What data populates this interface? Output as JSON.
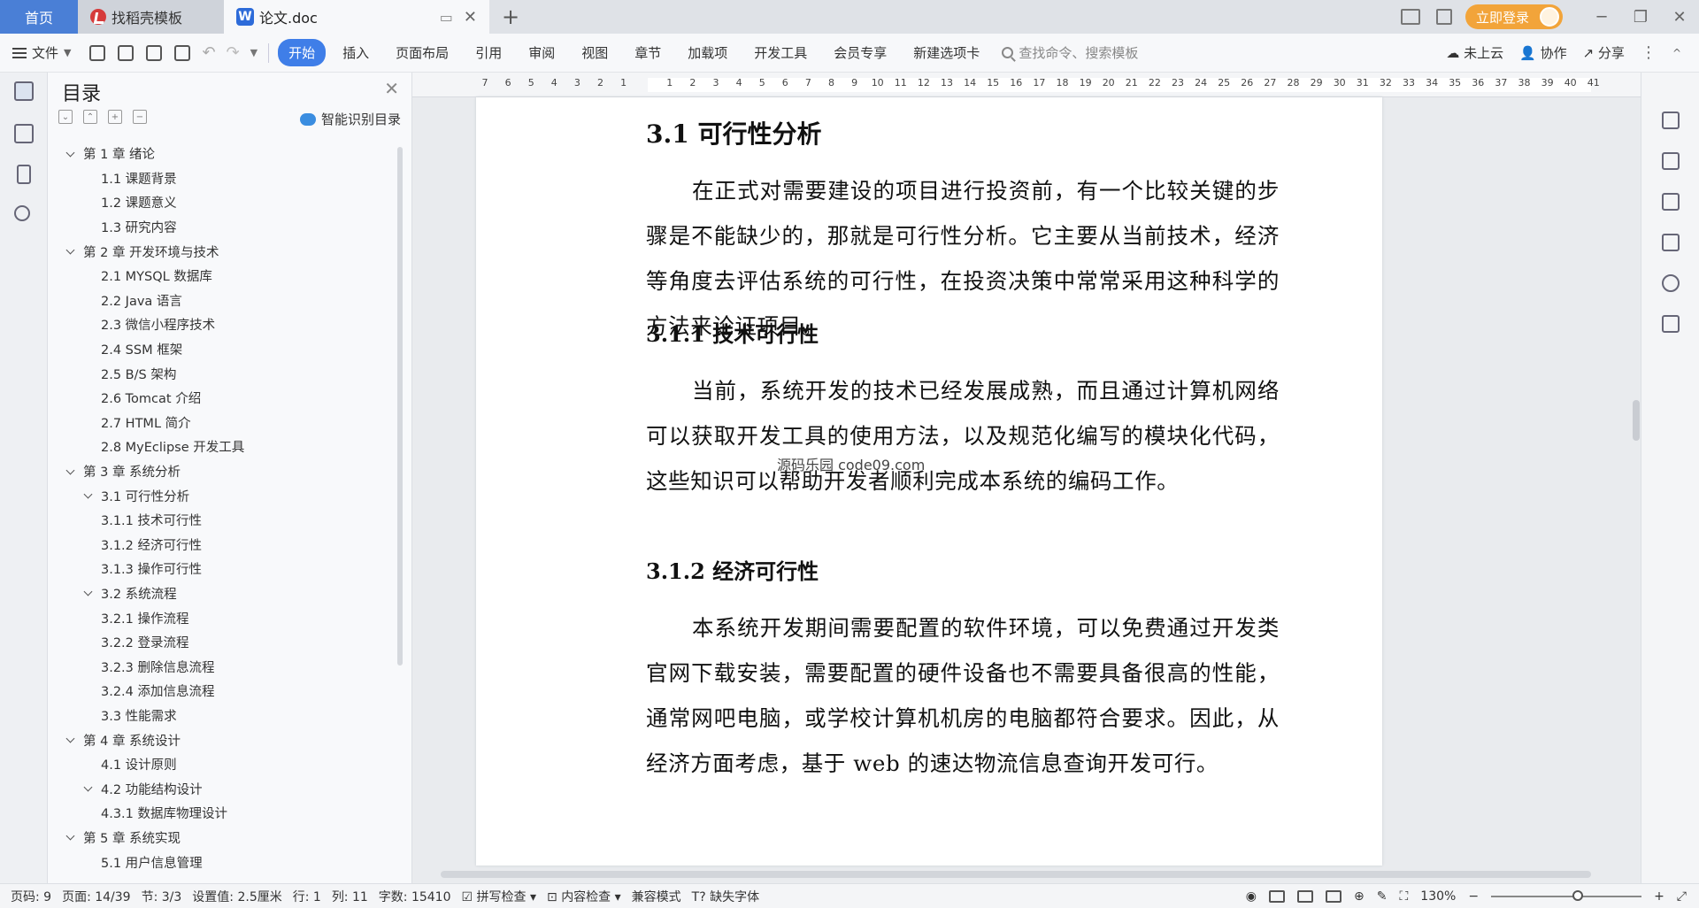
{
  "tabs": {
    "home": "首页",
    "template": "找稻壳模板",
    "doc": "论文.doc"
  },
  "titlebar": {
    "login": "立即登录"
  },
  "toolbar": {
    "file": "文件",
    "ribbon_tabs": [
      "开始",
      "插入",
      "页面布局",
      "引用",
      "审阅",
      "视图",
      "章节",
      "加载项",
      "开发工具",
      "会员专享",
      "新建选项卡"
    ],
    "search_placeholder": "查找命令、搜索模板",
    "cloud": "未上云",
    "collab": "协作",
    "share": "分享"
  },
  "toc": {
    "title": "目录",
    "smart": "智能识别目录",
    "items": [
      {
        "text": "第 1 章  绪论",
        "level": 0,
        "expand": true
      },
      {
        "text": "1.1  课题背景",
        "level": 1
      },
      {
        "text": "1.2  课题意义",
        "level": 1
      },
      {
        "text": "1.3  研究内容",
        "level": 1
      },
      {
        "text": "第 2 章  开发环境与技术",
        "level": 0,
        "expand": true
      },
      {
        "text": "2.1 MYSQL 数据库",
        "level": 1
      },
      {
        "text": "2.2 Java 语言",
        "level": 1
      },
      {
        "text": "2.3  微信小程序技术",
        "level": 1
      },
      {
        "text": "2.4 SSM 框架",
        "level": 1
      },
      {
        "text": "2.5 B/S 架构",
        "level": 1
      },
      {
        "text": "2.6 Tomcat  介绍",
        "level": 1
      },
      {
        "text": "2.7 HTML 简介",
        "level": 1
      },
      {
        "text": "2.8 MyEclipse 开发工具",
        "level": 1
      },
      {
        "text": "第 3 章  系统分析",
        "level": 0,
        "expand": true
      },
      {
        "text": "3.1  可行性分析",
        "level": 1,
        "expand": true
      },
      {
        "text": "3.1.1  技术可行性",
        "level": 2
      },
      {
        "text": "3.1.2  经济可行性",
        "level": 2
      },
      {
        "text": "3.1.3  操作可行性",
        "level": 2
      },
      {
        "text": "3.2  系统流程",
        "level": 1,
        "expand": true
      },
      {
        "text": "3.2.1  操作流程",
        "level": 2
      },
      {
        "text": "3.2.2  登录流程",
        "level": 2
      },
      {
        "text": "3.2.3  删除信息流程",
        "level": 2
      },
      {
        "text": "3.2.4  添加信息流程",
        "level": 2
      },
      {
        "text": "3.3  性能需求",
        "level": 1
      },
      {
        "text": "第 4 章  系统设计",
        "level": 0,
        "expand": true
      },
      {
        "text": "4.1  设计原则",
        "level": 1
      },
      {
        "text": "4.2  功能结构设计",
        "level": 1,
        "expand": true
      },
      {
        "text": "4.3.1  数据库物理设计",
        "level": 2
      },
      {
        "text": "第 5 章  系统实现",
        "level": 0,
        "expand": true
      },
      {
        "text": "5.1 用户信息管理",
        "level": 2
      }
    ]
  },
  "ruler": [
    "7",
    "6",
    "5",
    "4",
    "3",
    "2",
    "1",
    "",
    "1",
    "2",
    "3",
    "4",
    "5",
    "6",
    "7",
    "8",
    "9",
    "10",
    "11",
    "12",
    "13",
    "14",
    "15",
    "16",
    "17",
    "18",
    "19",
    "20",
    "21",
    "22",
    "23",
    "24",
    "25",
    "26",
    "27",
    "28",
    "29",
    "30",
    "31",
    "32",
    "33",
    "34",
    "35",
    "36",
    "37",
    "38",
    "39",
    "40",
    "41"
  ],
  "document": {
    "h_31": "3.1  可行性分析",
    "p1": "在正式对需要建设的项目进行投资前，有一个比较关键的步骤是不能缺少的，那就是可行性分析。它主要从当前技术，经济等角度去评估系统的可行性，在投资决策中常常采用这种科学的方法来论证项目。",
    "h_311": "3.1.1  技术可行性",
    "p2": "当前，系统开发的技术已经发展成熟，而且通过计算机网络可以获取开发工具的使用方法，以及规范化编写的模块化代码，这些知识可以帮助开发者顺利完成本系统的编码工作。",
    "h_312": "3.1.2  经济可行性",
    "p3": "本系统开发期间需要配置的软件环境，可以免费通过开发类官网下载安装，需要配置的硬件设备也不需要具备很高的性能，通常网吧电脑，或学校计算机机房的电脑都符合要求。因此，从经济方面考虑，基于 web 的速达物流信息查询开发可行。",
    "watermark": "源码乐园 code09.com"
  },
  "status": {
    "page": "页码: 9",
    "pages": "页面: 14/39",
    "section": "节: 3/3",
    "setting": "设置值: 2.5厘米",
    "row": "行: 1",
    "col": "列: 11",
    "words": "字数: 15410",
    "spell": "拼写检查",
    "content_check": "内容检查",
    "compat": "兼容模式",
    "missing_font": "缺失字体",
    "zoom": "130%"
  },
  "colors": {
    "accent": "#3f7ee8",
    "home_tab": "#4a7fd6",
    "login": "#f2a43a"
  }
}
